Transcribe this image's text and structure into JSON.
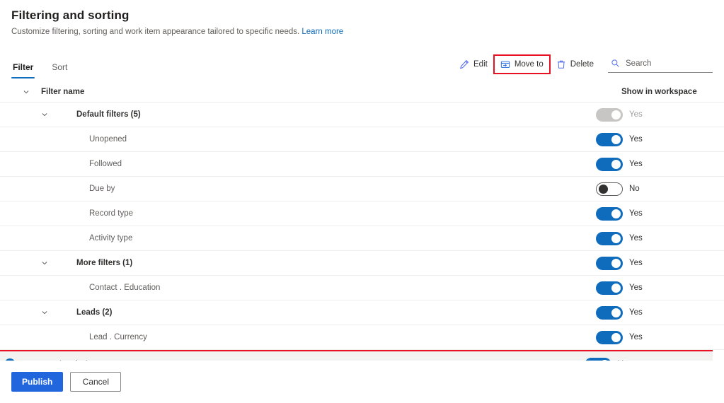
{
  "header": {
    "title": "Filtering and sorting",
    "subtitle": "Customize filtering, sorting and work item appearance tailored to specific needs.",
    "learn_more": "Learn more"
  },
  "tabs": [
    {
      "label": "Filter",
      "active": true
    },
    {
      "label": "Sort",
      "active": false
    }
  ],
  "toolbar": {
    "edit_label": "Edit",
    "move_to_label": "Move to",
    "delete_label": "Delete",
    "highlight_color": "#e81123"
  },
  "search": {
    "placeholder": "Search",
    "value": ""
  },
  "table": {
    "columns": {
      "filter_name": "Filter name",
      "show_in_workspace": "Show in workspace"
    },
    "rows": [
      {
        "label": "Default filters (5)",
        "level": 0,
        "group": true,
        "expanded": true,
        "toggle": "disabled",
        "toggle_label": "Yes",
        "selected": false
      },
      {
        "label": "Unopened",
        "level": 1,
        "group": false,
        "toggle": "on",
        "toggle_label": "Yes",
        "selected": false
      },
      {
        "label": "Followed",
        "level": 1,
        "group": false,
        "toggle": "on",
        "toggle_label": "Yes",
        "selected": false
      },
      {
        "label": "Due by",
        "level": 1,
        "group": false,
        "toggle": "off",
        "toggle_label": "No",
        "selected": false
      },
      {
        "label": "Record type",
        "level": 1,
        "group": false,
        "toggle": "on",
        "toggle_label": "Yes",
        "selected": false
      },
      {
        "label": "Activity type",
        "level": 1,
        "group": false,
        "toggle": "on",
        "toggle_label": "Yes",
        "selected": false
      },
      {
        "label": "More filters (1)",
        "level": 0,
        "group": true,
        "expanded": true,
        "toggle": "on",
        "toggle_label": "Yes",
        "selected": false
      },
      {
        "label": "Contact . Education",
        "level": 1,
        "group": false,
        "toggle": "on",
        "toggle_label": "Yes",
        "selected": false
      },
      {
        "label": "Leads (2)",
        "level": 0,
        "group": true,
        "expanded": true,
        "toggle": "on",
        "toggle_label": "Yes",
        "selected": false
      },
      {
        "label": "Lead . Currency",
        "level": 1,
        "group": false,
        "toggle": "on",
        "toggle_label": "Yes",
        "selected": false
      },
      {
        "label": "Lead . Account",
        "level": 1,
        "group": false,
        "toggle": "on",
        "toggle_label": "Yes",
        "selected": true
      }
    ]
  },
  "footer": {
    "publish_label": "Publish",
    "cancel_label": "Cancel"
  },
  "colors": {
    "accent": "#0f6cbd",
    "primary_button": "#2266dd",
    "highlight": "#e81123",
    "selected_row": "#f3f2f1"
  }
}
